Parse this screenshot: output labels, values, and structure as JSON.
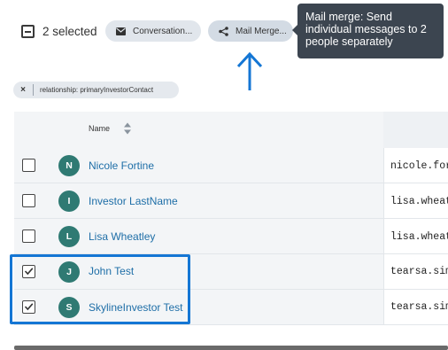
{
  "toolbar": {
    "selected_text": "2 selected",
    "conversation_label": "Conversation...",
    "mail_merge_label": "Mail Merge..."
  },
  "tooltip": {
    "text": "Mail merge: Send individual messages to 2 people separately"
  },
  "filter_chip": {
    "close_symbol": "×",
    "label": "relationship: primaryInvestorContact"
  },
  "table": {
    "columns": [
      "Name"
    ],
    "rows": [
      {
        "initial": "N",
        "name": "Nicole Fortine",
        "email": "nicole.fortine@",
        "checked": false
      },
      {
        "initial": "I",
        "name": "Investor LastName",
        "email": "lisa.wheatley@",
        "checked": false
      },
      {
        "initial": "L",
        "name": "Lisa Wheatley",
        "email": "lisa.wheatley@",
        "checked": false
      },
      {
        "initial": "J",
        "name": "John Test",
        "email": "tearsa.sim@",
        "checked": true
      },
      {
        "initial": "S",
        "name": "SkylineInvestor Test",
        "email": "tearsa.sim@",
        "checked": true
      }
    ]
  },
  "colors": {
    "accent_blue": "#1476d4",
    "avatar_teal": "#2f7a73",
    "link_blue": "#1e6ea7",
    "tooltip_bg": "#3c4550"
  },
  "icons": {
    "select_all": "minus-checkbox-icon",
    "conversation": "envelope-icon",
    "mail_merge": "share-nodes-icon",
    "sort": "sort-updown-icon",
    "annotation": "arrow-up-icon"
  }
}
